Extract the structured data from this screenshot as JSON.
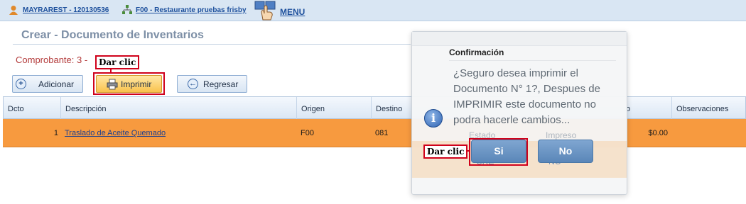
{
  "topbar": {
    "user_link": "MAYRAREST - 120130536",
    "company_link": "F00 - Restaurante pruebas frisby",
    "menu_label": "MENU"
  },
  "page": {
    "title": "Crear - Documento de Inventarios",
    "comprobante": "Comprobante: 3 -"
  },
  "annotations": {
    "click_label_1": "Dar clic",
    "click_label_2": "Dar clic"
  },
  "toolbar": {
    "add_label": "Adicionar",
    "print_label": "Imprimir",
    "back_label": "Regresar"
  },
  "grid": {
    "headers": {
      "dcto": "Dcto",
      "descripcion": "Descripción",
      "origen": "Origen",
      "destino": "Destino",
      "valor_partial": "o",
      "observaciones": "Observaciones"
    },
    "rows": [
      {
        "dcto": "1",
        "descripcion": "Traslado de Aceite Quemado",
        "origen": "F00",
        "destino": "081",
        "valor": "$0.00",
        "observaciones": ""
      }
    ]
  },
  "dialog": {
    "title": "Confirmación",
    "message": "¿Seguro desea imprimir el Documento N° 1?, Despues de IMPRIMIR este documento no podra hacerle cambios...",
    "yes_label": "Si",
    "no_label": "No",
    "ghost_estado": "Estado",
    "ghost_impreso": "Impreso",
    "ghost_cre": "CRE",
    "ghost_no": "NO"
  },
  "colors": {
    "row_highlight": "#f79a3f",
    "annotation_red": "#d0021b",
    "link_blue": "#1c4f9c"
  }
}
